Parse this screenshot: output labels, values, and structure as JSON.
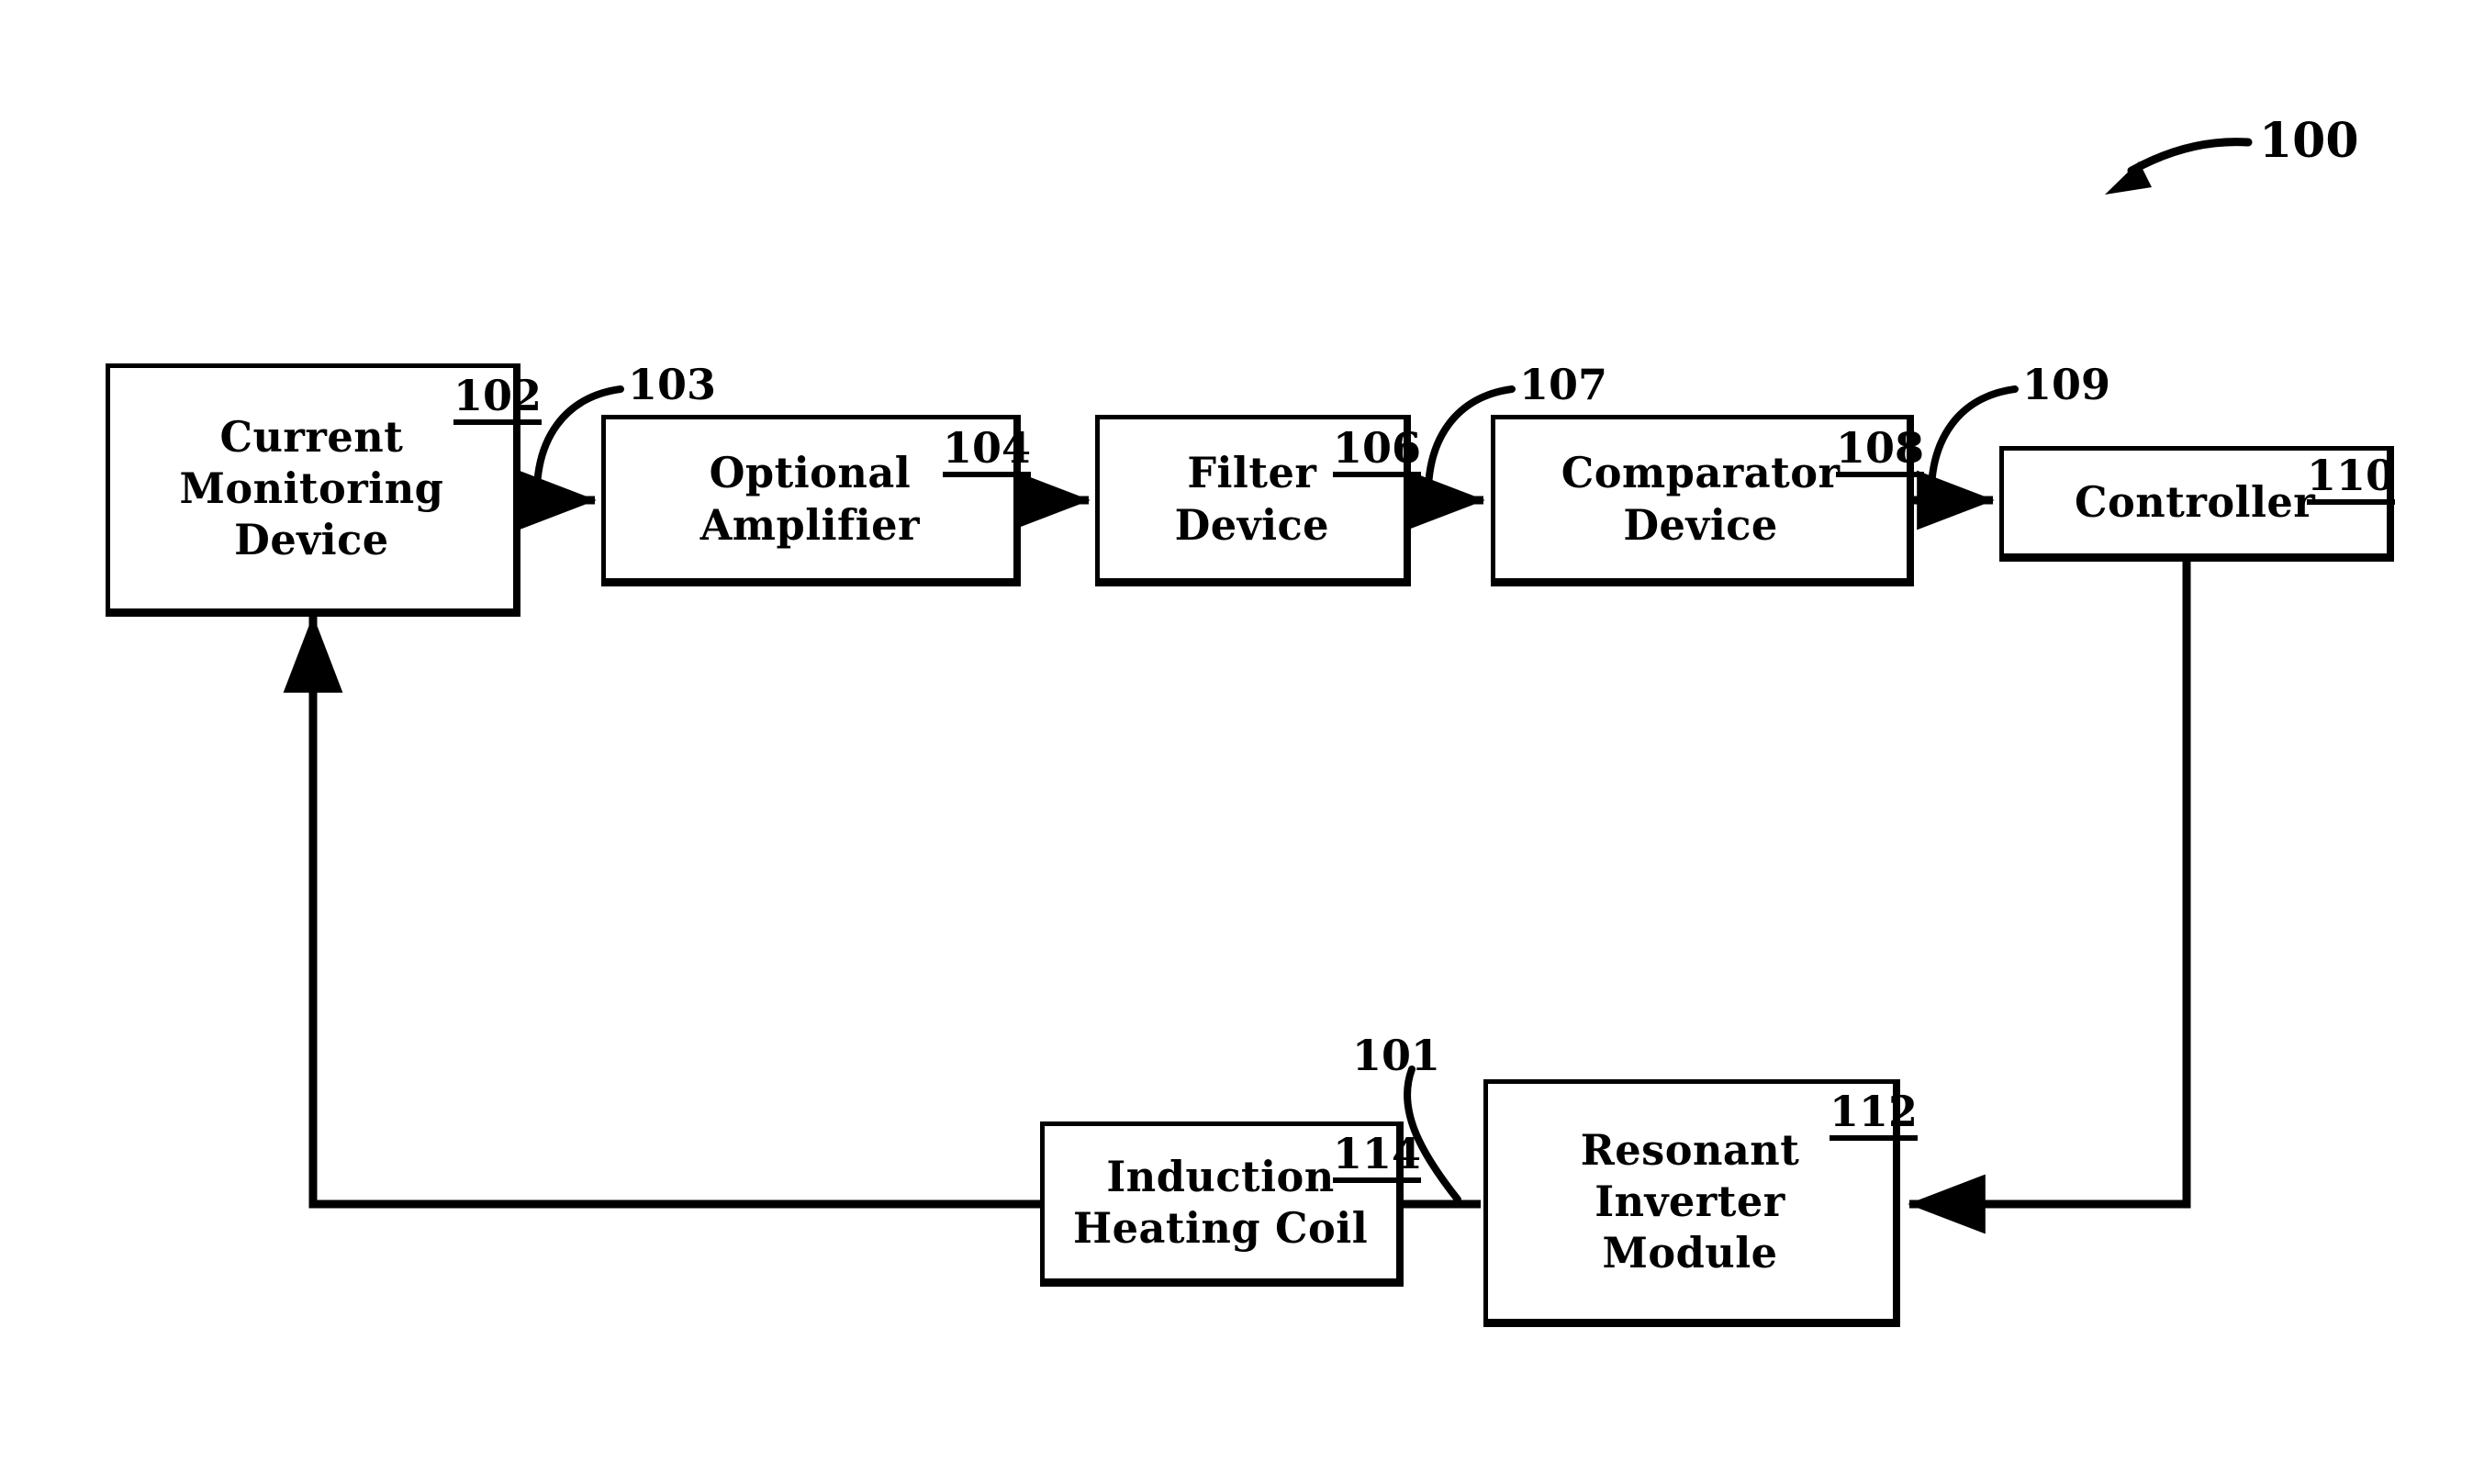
{
  "figure": {
    "figure_number": "100",
    "background_color": "#ffffff",
    "line_color": "#000000"
  },
  "blocks": [
    {
      "id": "current-monitoring-device",
      "label": "Current\nMonitoring\nDevice",
      "ref": "102"
    },
    {
      "id": "optional-amplifier",
      "label": "Optional\nAmplifier",
      "ref": "104"
    },
    {
      "id": "filter-device",
      "label": "Filter\nDevice",
      "ref": "106"
    },
    {
      "id": "comparator-device",
      "label": "Comparator\nDevice",
      "ref": "108"
    },
    {
      "id": "controller",
      "label": "Controller",
      "ref": "110"
    },
    {
      "id": "resonant-inverter-module",
      "label": "Resonant\nInverter\nModule",
      "ref": "112"
    },
    {
      "id": "induction-heating-coil",
      "label": "Induction\nHeating Coil",
      "ref": "114"
    }
  ],
  "signal_labels": [
    {
      "id": "signal-103",
      "ref": "103"
    },
    {
      "id": "signal-107",
      "ref": "107"
    },
    {
      "id": "signal-109",
      "ref": "109"
    },
    {
      "id": "signal-101",
      "ref": "101"
    }
  ]
}
